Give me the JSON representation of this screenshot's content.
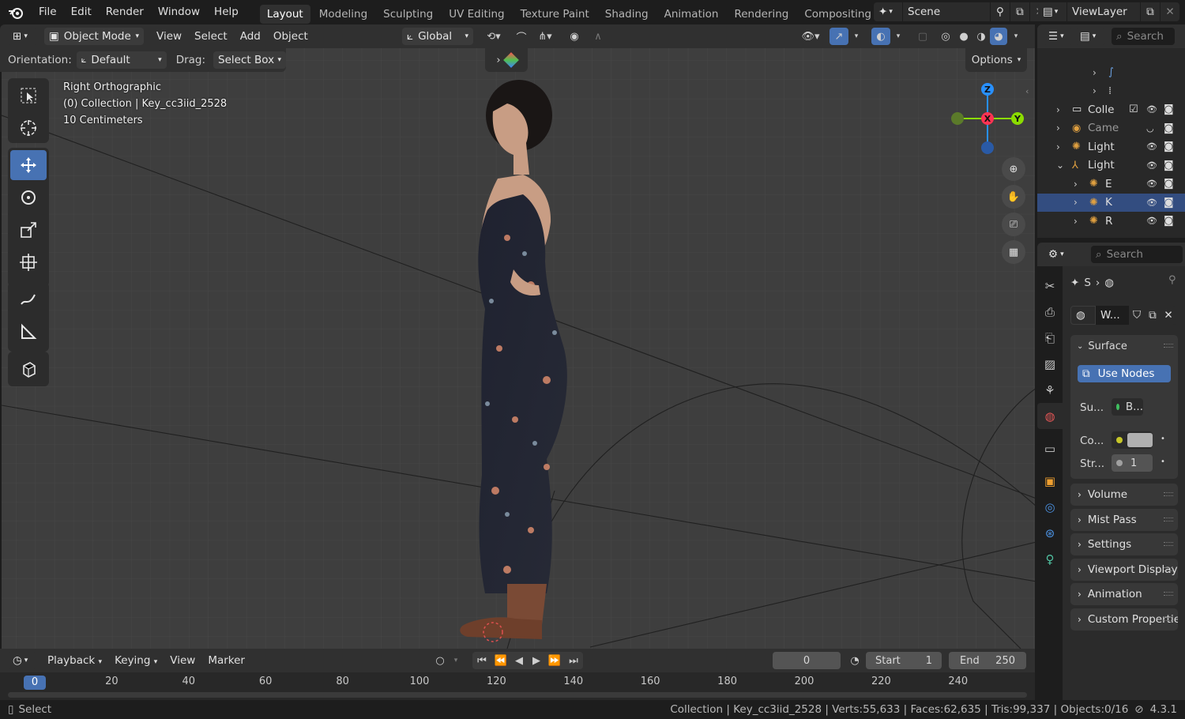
{
  "top_menu": [
    "File",
    "Edit",
    "Render",
    "Window",
    "Help"
  ],
  "workspaces": [
    "Layout",
    "Modeling",
    "Sculpting",
    "UV Editing",
    "Texture Paint",
    "Shading",
    "Animation",
    "Rendering",
    "Compositing"
  ],
  "active_workspace": "Layout",
  "scene_name": "Scene",
  "view_layer": "ViewLayer",
  "viewport_header": {
    "mode": "Object Mode",
    "menus": [
      "View",
      "Select",
      "Add",
      "Object"
    ],
    "transform_orientation": "Global"
  },
  "tool_settings": {
    "orientation_label": "Orientation:",
    "orientation_value": "Default",
    "drag_label": "Drag:",
    "drag_value": "Select Box",
    "options_label": "Options"
  },
  "viewport_info": {
    "view_name": "Right Orthographic",
    "collection_line": "(0) Collection | Key_cc3iid_2528",
    "scale": "10 Centimeters"
  },
  "gizmo": {
    "z": "Z",
    "x": "X",
    "y": "Y"
  },
  "outliner": {
    "search_placeholder": "Search",
    "rows": [
      {
        "label": "",
        "indent": 3,
        "icon": "curve-icon"
      },
      {
        "label": "",
        "indent": 3,
        "icon": "vertex-group-icon"
      },
      {
        "label": "Colle",
        "indent": 1,
        "icon": "collection-icon"
      },
      {
        "label": "Came",
        "indent": 1,
        "icon": "camera-icon"
      },
      {
        "label": "Light",
        "indent": 1,
        "icon": "light-icon"
      },
      {
        "label": "Light",
        "indent": 1,
        "icon": "armature-icon"
      },
      {
        "label": "E",
        "indent": 2,
        "icon": "light-icon"
      },
      {
        "label": "K",
        "indent": 2,
        "icon": "light-icon"
      },
      {
        "label": "R",
        "indent": 2,
        "icon": "light-icon"
      }
    ],
    "selected_row": 7
  },
  "properties": {
    "search_placeholder": "Search",
    "breadcrumb": "S",
    "world_name": "W...",
    "surface_label": "Surface",
    "use_nodes_label": "Use Nodes",
    "surface_field_label": "Su...",
    "surface_value": "B...",
    "color_label": "Co...",
    "strength_label": "Str...",
    "strength_value": "1",
    "panels": [
      "Volume",
      "Mist Pass",
      "Settings",
      "Viewport Display",
      "Animation",
      "Custom Properties"
    ]
  },
  "timeline": {
    "menus": [
      "Playback",
      "Keying",
      "View",
      "Marker"
    ],
    "current_frame": "0",
    "start_label": "Start",
    "start_value": "1",
    "end_label": "End",
    "end_value": "250",
    "ruler_current": "0",
    "ruler_ticks": [
      "20",
      "40",
      "60",
      "80",
      "100",
      "120",
      "140",
      "160",
      "180",
      "200",
      "220",
      "240"
    ]
  },
  "status_bar": {
    "left_label": "Select",
    "stats": "Collection | Key_cc3iid_2528 | Verts:55,633 | Faces:62,635 | Tris:99,337 | Objects:0/16",
    "version": "4.3.1"
  },
  "colors": {
    "accent": "#4772b3",
    "selected_row": "#334d80",
    "axis_x": "#ff3352",
    "axis_y": "#8bdc00",
    "axis_z": "#2890ff"
  }
}
